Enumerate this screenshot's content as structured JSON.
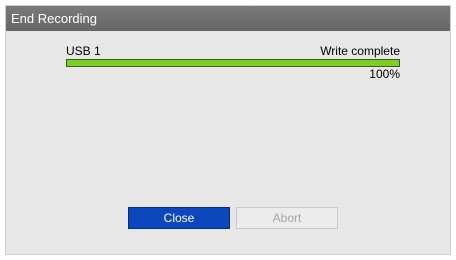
{
  "dialog": {
    "title": "End Recording"
  },
  "device": {
    "name": "USB 1",
    "status": "Write complete",
    "progress_percent": 100,
    "progress_text": "100%"
  },
  "buttons": {
    "close_label": "Close",
    "abort_label": "Abort"
  },
  "colors": {
    "titlebar": "#6e6e6e",
    "progress_fill": "#7bcf28",
    "primary_button": "#0c47bd",
    "dialog_background": "#e7e7e7"
  }
}
